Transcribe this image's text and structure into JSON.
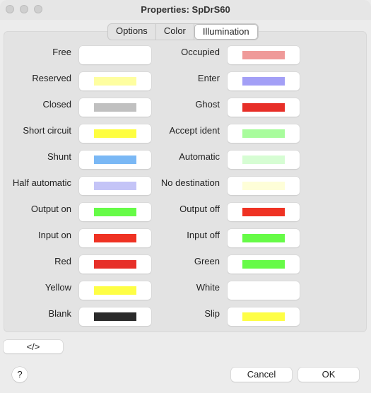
{
  "window": {
    "title": "Properties: SpDrS60"
  },
  "tabs": [
    {
      "label": "Options",
      "active": false
    },
    {
      "label": "Color",
      "active": false
    },
    {
      "label": "Illumination",
      "active": true
    }
  ],
  "left_items": [
    {
      "label": "Free",
      "color": "#ffffff"
    },
    {
      "label": "Reserved",
      "color": "#fefea0"
    },
    {
      "label": "Closed",
      "color": "#c0c0c0"
    },
    {
      "label": "Short circuit",
      "color": "#fefe40"
    },
    {
      "label": "Shunt",
      "color": "#7ab8f5"
    },
    {
      "label": "Half automatic",
      "color": "#c4c4f7"
    },
    {
      "label": "Output on",
      "color": "#66fb47"
    },
    {
      "label": "Input on",
      "color": "#ef3223"
    },
    {
      "label": "Red",
      "color": "#e72f28"
    },
    {
      "label": "Yellow",
      "color": "#fefe45"
    },
    {
      "label": "Blank",
      "color": "#2a2a2a"
    }
  ],
  "right_items": [
    {
      "label": "Occupied",
      "color": "#ef9a99"
    },
    {
      "label": "Enter",
      "color": "#a39ff6"
    },
    {
      "label": "Ghost",
      "color": "#e72f28"
    },
    {
      "label": "Accept ident",
      "color": "#a8fc9c"
    },
    {
      "label": "Automatic",
      "color": "#d6fdd3"
    },
    {
      "label": "No destination",
      "color": "#fefed8"
    },
    {
      "label": "Output off",
      "color": "#ef3223"
    },
    {
      "label": "Input off",
      "color": "#66fb47"
    },
    {
      "label": "Green",
      "color": "#66fb47"
    },
    {
      "label": "White",
      "color": "#ffffff"
    },
    {
      "label": "Slip",
      "color": "#fefe45"
    }
  ],
  "buttons": {
    "xml_label": "</>",
    "help_label": "?",
    "cancel_label": "Cancel",
    "ok_label": "OK"
  }
}
